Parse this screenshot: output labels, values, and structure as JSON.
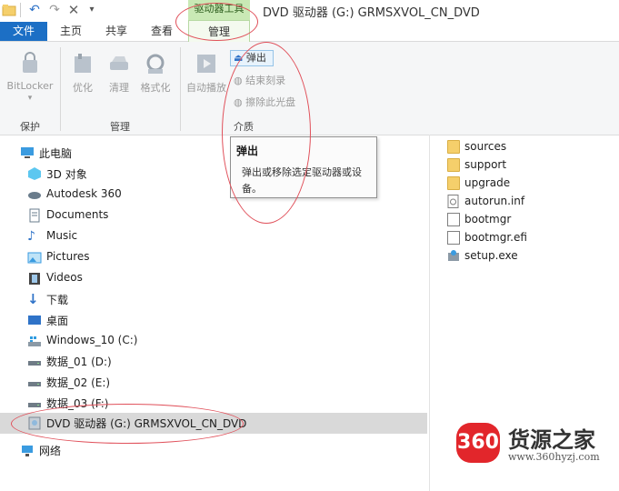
{
  "title_bar": {
    "context_tab": "驱动器工具",
    "window_title": "DVD 驱动器 (G:) GRMSXVOL_CN_DVD"
  },
  "tabs": {
    "file": "文件",
    "home": "主页",
    "share": "共享",
    "view": "查看",
    "manage": "管理"
  },
  "ribbon": {
    "bitlocker": "BitLocker",
    "protect_group": "保护",
    "optimize": "优化",
    "cleanup": "清理",
    "format": "格式化",
    "manage_group": "管理",
    "autoplay": "自动播放",
    "eject": "弹出",
    "finish_burn": "结束刻录",
    "erase_disc": "擦除此光盘",
    "media_group": "介质"
  },
  "tooltip": {
    "title": "弹出",
    "body_line1": "弹出或移除选定驱动器或设",
    "body_line2": "备。"
  },
  "nav": {
    "this_pc": "此电脑",
    "items": [
      "3D 对象",
      "Autodesk 360",
      "Documents",
      "Music",
      "Pictures",
      "Videos",
      "下载",
      "桌面",
      "Windows_10 (C:)",
      "数据_01 (D:)",
      "数据_02 (E:)",
      "数据_03 (F:)"
    ],
    "dvd_drive": "DVD 驱动器 (G:) GRMSXVOL_CN_DVD",
    "network": "网络"
  },
  "files": [
    {
      "name": "sources",
      "kind": "folder"
    },
    {
      "name": "support",
      "kind": "folder"
    },
    {
      "name": "upgrade",
      "kind": "folder"
    },
    {
      "name": "autorun.inf",
      "kind": "file"
    },
    {
      "name": "bootmgr",
      "kind": "file"
    },
    {
      "name": "bootmgr.efi",
      "kind": "file"
    },
    {
      "name": "setup.exe",
      "kind": "exe"
    }
  ],
  "watermark": {
    "badge": "360",
    "brand": "货源之家",
    "url": "www.360hyzj.com"
  },
  "colors": {
    "accent_blue": "#1c6fc5",
    "context_green": "#c9e9b5",
    "annotation_red": "#e0505a"
  }
}
